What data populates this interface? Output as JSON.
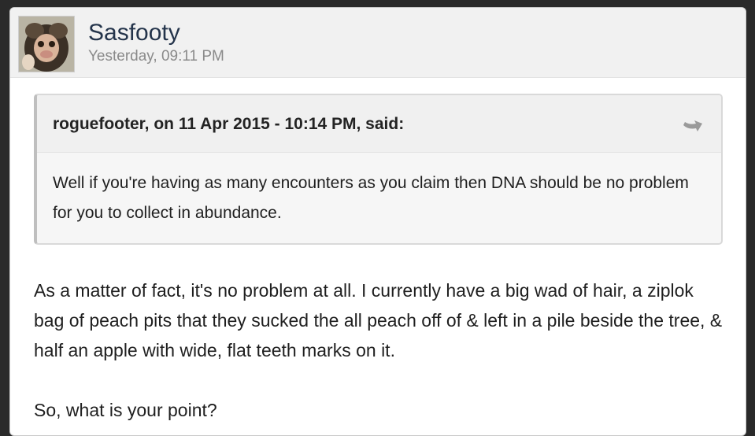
{
  "post": {
    "author": "Sasfooty",
    "timestamp": "Yesterday, 09:11 PM",
    "avatar_icon": "monkey-avatar"
  },
  "quote": {
    "citation": "roguefooter, on 11 Apr 2015 - 10:14 PM, said:",
    "text": "Well if you're having as many encounters as you claim then DNA should be no problem for you to collect in abundance.",
    "icon": "quote-return-icon"
  },
  "body": {
    "paragraph_1": "As a matter of fact, it's no problem at all. I currently have a big wad of hair, a ziplok bag of peach pits that they sucked the all peach off of & left in a pile beside the tree, & half an apple with wide, flat teeth marks on it.",
    "paragraph_2": "So, what is your point?"
  },
  "colors": {
    "author": "#24344b",
    "timestamp": "#8a8a8a",
    "header_bg": "#f1f1f1",
    "quote_bg": "#f6f6f6"
  }
}
